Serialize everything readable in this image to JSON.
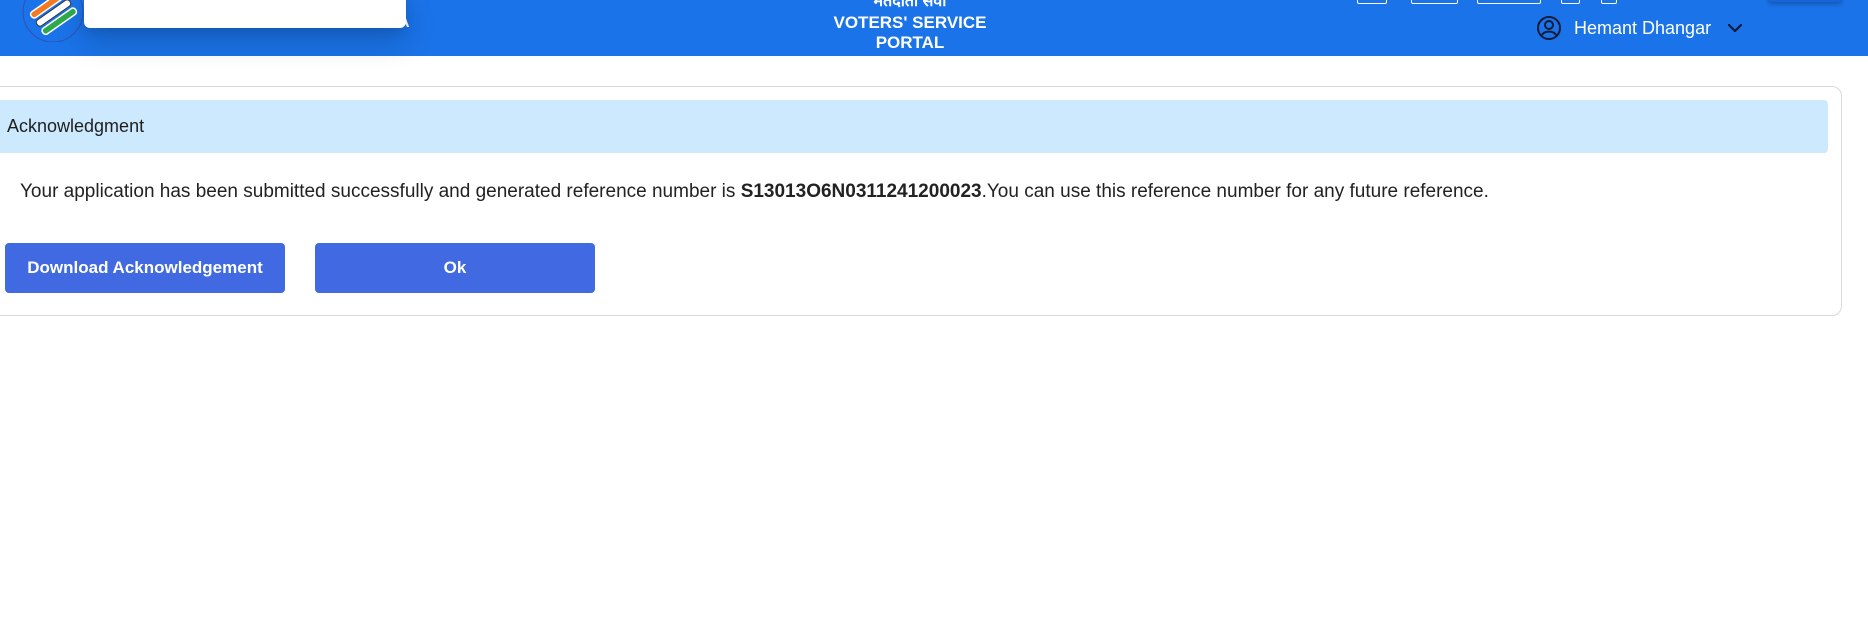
{
  "header": {
    "org_name_visible": "A",
    "portal_title_hindi": "मतदाता सेवा",
    "portal_title": "VOTERS' SERVICE PORTAL",
    "user_name": "Hemant Dhangar",
    "logo_icon": "eci-logo-icon",
    "user_icon": "user-circle-icon",
    "dropdown_icon": "chevron-down-icon",
    "accent_color": "#1a73e8"
  },
  "acknowledgment": {
    "title": "Acknowledgment",
    "message_prefix": "Your application has been submitted successfully and generated reference number is ",
    "reference_number": "S13013O6N0311241200023",
    "message_suffix": ".You can use this reference number for any future reference.",
    "header_bg_color": "#cce9fd"
  },
  "actions": {
    "download_label": "Download Acknowledgement",
    "ok_label": "Ok",
    "button_color": "#4169e1"
  }
}
